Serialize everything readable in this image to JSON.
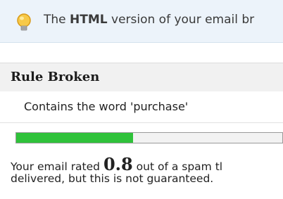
{
  "notice": {
    "prefix": "The ",
    "emphasis": "HTML",
    "suffix": " version of your email br",
    "icon": "lightbulb-icon"
  },
  "rule": {
    "header": "Rule Broken",
    "item": "Contains the word 'purchase'"
  },
  "meter": {
    "fraction": 0.44,
    "fill_color": "#2fc23a"
  },
  "result": {
    "line1_prefix": "Your email rated ",
    "score": "0.8",
    "line1_suffix": " out of a spam tl",
    "line2": "delivered, but this is not guaranteed."
  }
}
